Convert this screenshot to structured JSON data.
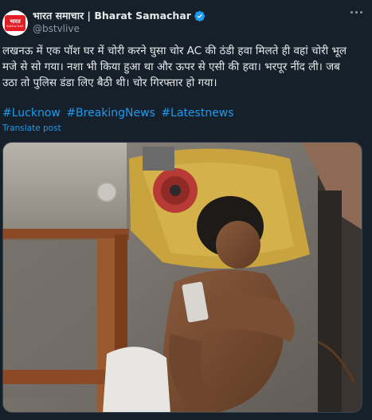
{
  "account": {
    "name": "भारत समाचार | Bharat Samachar",
    "handle": "@bstvlive",
    "avatar_text_top": "भारत",
    "avatar_text_bottom": "SAMACHAR"
  },
  "post": {
    "line1": "लखनऊ में एक पॉश घर में चोरी करने घुसा चोर AC की ठंडी हवा मिलते ही वहां चोरी भूल",
    "line2": "मजे से सो गया। नशा भी किया हुआ था और ऊपर से एसी की हवा। भरपूर नींद ली। जब",
    "line3": "उठा तो पुलिस डंडा लिए बैठी थी। चोर गिरफ्तार हो गया।",
    "hashtags": [
      "#Lucknow",
      "#BreakingNews",
      "#Latestnews"
    ],
    "translate_label": "Translate post"
  },
  "media": {
    "description": "photo"
  },
  "colors": {
    "background": "#15202b",
    "text": "#e7e9ea",
    "muted": "#8b98a5",
    "accent": "#1d9bf0",
    "verified": "#1d9bf0",
    "brand_red": "#e31d25"
  },
  "icons": {
    "verified": "verified-badge-icon",
    "more": "more-options-icon"
  }
}
